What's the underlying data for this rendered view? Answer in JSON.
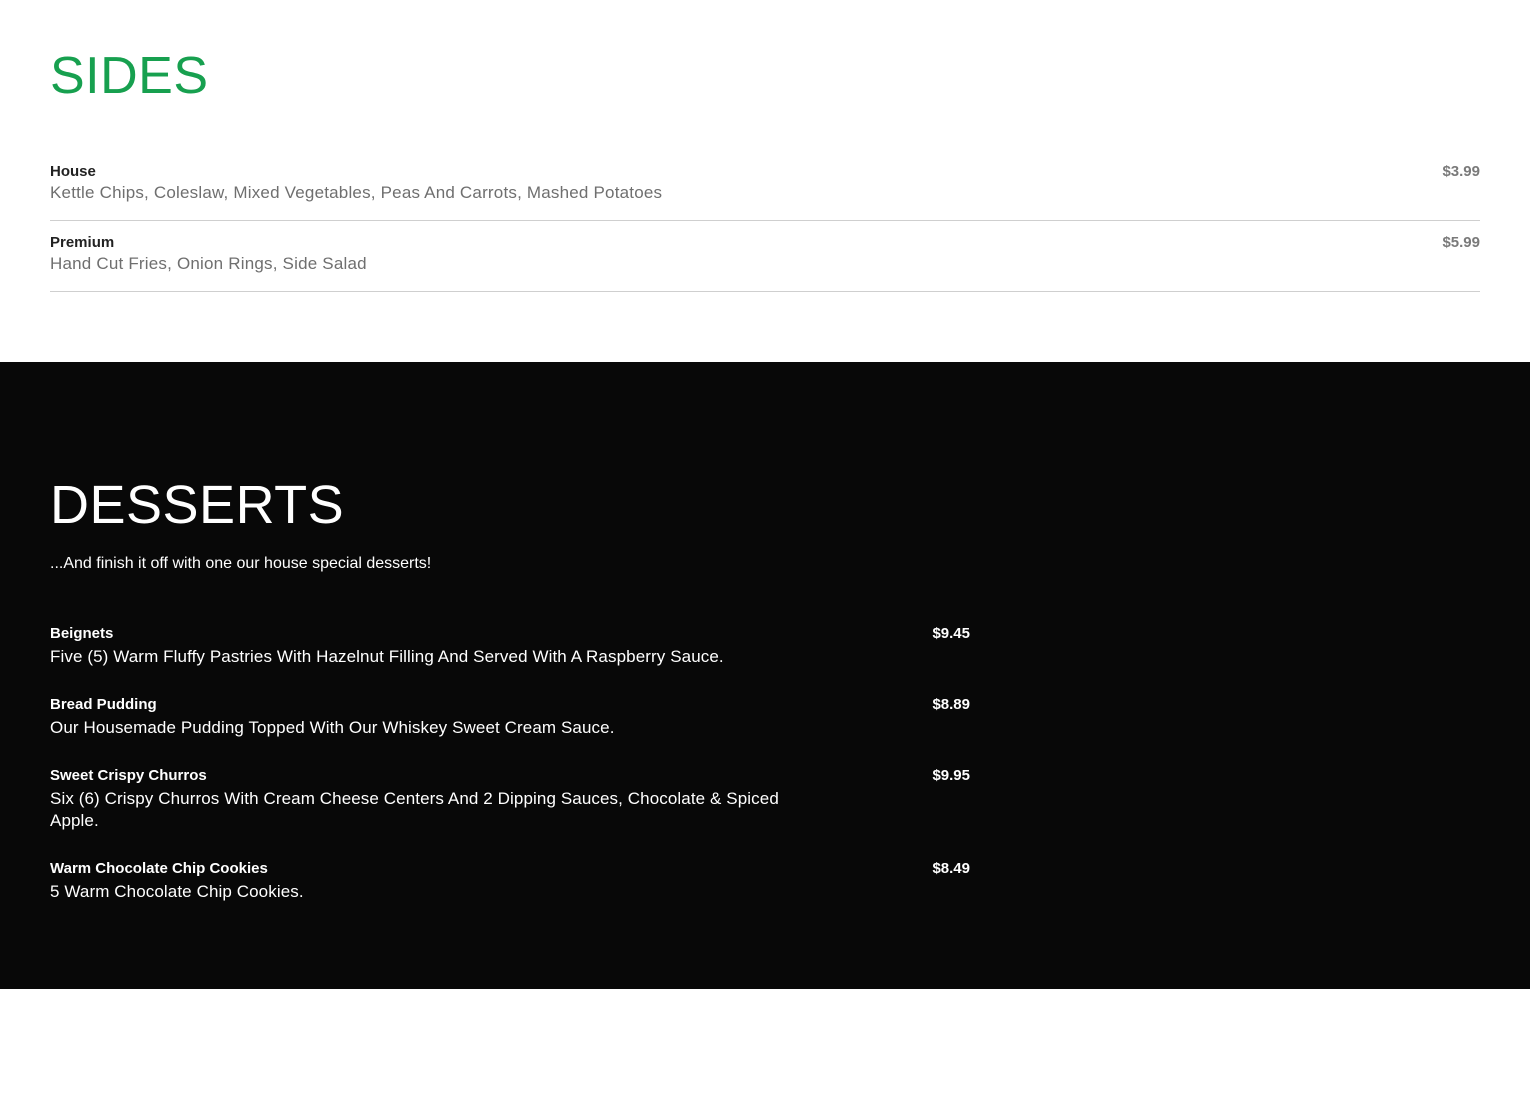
{
  "sides": {
    "title": "SIDES",
    "items": [
      {
        "name": "House",
        "description": "Kettle Chips, Coleslaw, Mixed Vegetables, Peas And Carrots, Mashed Potatoes",
        "price": "$3.99"
      },
      {
        "name": "Premium",
        "description": "Hand Cut Fries, Onion Rings, Side Salad",
        "price": "$5.99"
      }
    ]
  },
  "desserts": {
    "title": "DESSERTS",
    "subtitle": "...And finish it off with one our house special desserts!",
    "items": [
      {
        "name": "Beignets",
        "description": "Five (5) Warm Fluffy Pastries With Hazelnut Filling And Served With A Raspberry Sauce.",
        "price": "$9.45"
      },
      {
        "name": "Bread Pudding",
        "description": "Our Housemade Pudding Topped With Our Whiskey Sweet Cream Sauce.",
        "price": "$8.89"
      },
      {
        "name": "Sweet Crispy Churros",
        "description": "Six (6) Crispy Churros With Cream Cheese Centers And 2 Dipping Sauces, Chocolate & Spiced Apple.",
        "price": "$9.95"
      },
      {
        "name": "Warm Chocolate Chip Cookies",
        "description": "5 Warm Chocolate Chip Cookies.",
        "price": "$8.49"
      }
    ]
  },
  "colors": {
    "accent_green": "#17a04f",
    "dark_background": "#080808",
    "light_background": "#ffffff",
    "divider": "#cfcfcf",
    "muted_text": "#6f6f6f"
  }
}
